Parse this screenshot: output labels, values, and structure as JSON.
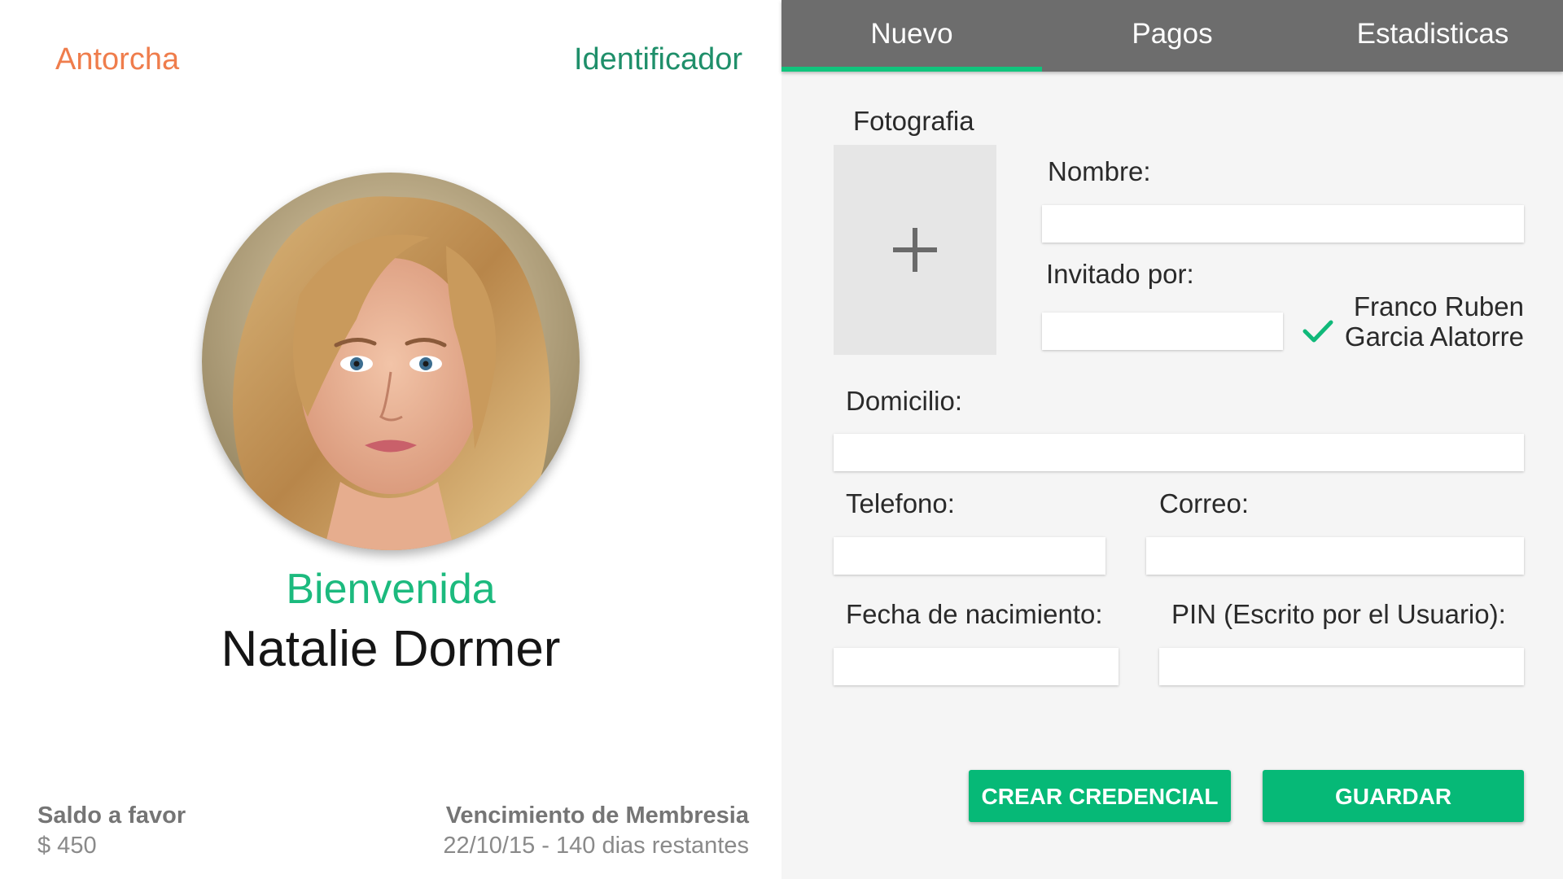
{
  "header": {
    "brand": "Antorcha",
    "identifier_link": "Identificador"
  },
  "profile": {
    "greeting": "Bienvenida",
    "name": "Natalie Dormer",
    "avatar_icon": "user-photo"
  },
  "balance": {
    "label": "Saldo a favor",
    "value": "$ 450"
  },
  "membership": {
    "label": "Vencimiento de Membresia",
    "value": "22/10/15 - 140 dias restantes"
  },
  "tabs": [
    {
      "label": "Nuevo",
      "active": true
    },
    {
      "label": "Pagos",
      "active": false
    },
    {
      "label": "Estadisticas",
      "active": false
    }
  ],
  "form": {
    "photo_label": "Fotografia",
    "photo_icon": "plus-icon",
    "name_label": "Nombre:",
    "name_value": "",
    "invited_label": "Invitado por:",
    "invited_value": "",
    "inviter_name_line1": "Franco Ruben",
    "inviter_name_line2": "Garcia Alatorre",
    "address_label": "Domicilio:",
    "address_value": "",
    "phone_label": "Telefono:",
    "phone_value": "",
    "email_label": "Correo:",
    "email_value": "",
    "birthdate_label": "Fecha de nacimiento:",
    "birthdate_value": "",
    "pin_label": "PIN (Escrito por el Usuario):",
    "pin_value": ""
  },
  "actions": {
    "create_credential": "CREAR CREDENCIAL",
    "save": "GUARDAR"
  },
  "colors": {
    "accent_green": "#06b977",
    "brand_orange": "#ef7d4c",
    "tabbar_gray": "#6d6d6d"
  }
}
